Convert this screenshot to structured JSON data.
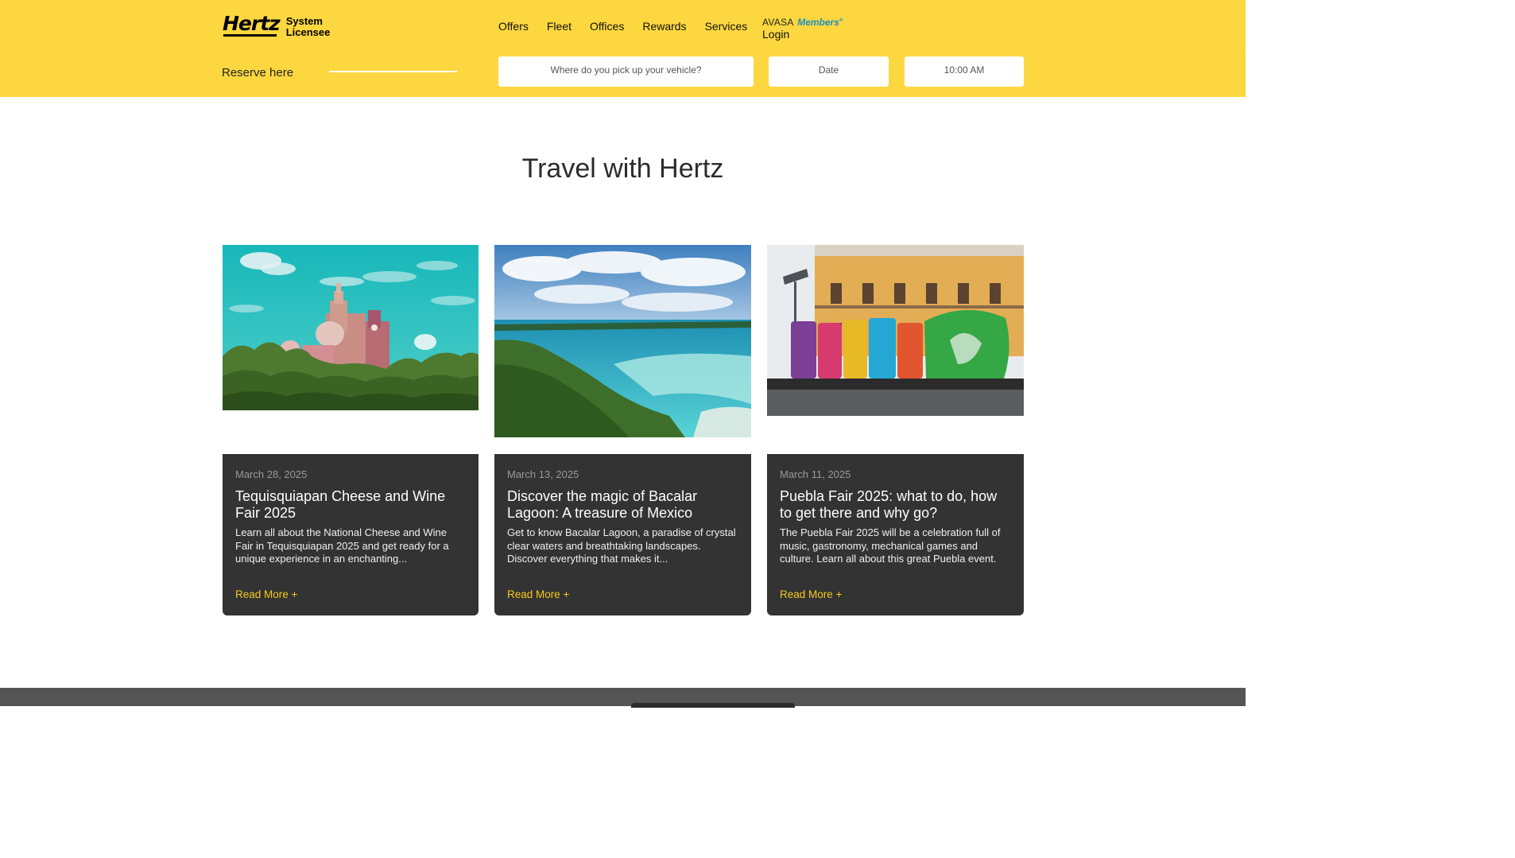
{
  "brand": {
    "logo_text": "Hertz",
    "sub_line1": "System",
    "sub_line2": "Licensee",
    "accent_color": "#fdd73f"
  },
  "nav": {
    "items": [
      {
        "label": "Offers"
      },
      {
        "label": "Fleet"
      },
      {
        "label": "Offices"
      },
      {
        "label": "Rewards"
      },
      {
        "label": "Services"
      }
    ],
    "login": {
      "program": "AVASA",
      "members": "Members",
      "label": "Login"
    }
  },
  "reserve": {
    "label": "Reserve here",
    "location_placeholder": "Where do you pick up your vehicle?",
    "date_placeholder": "Date",
    "time_value": "10:00 AM"
  },
  "main": {
    "title": "Travel with Hertz",
    "cards": [
      {
        "date": "March 28, 2025",
        "title": "Tequisquiapan Cheese and Wine Fair 2025",
        "description": "Learn all about the National Cheese and Wine Fair in Tequisquiapan 2025 and get ready for a unique experience in an enchanting...",
        "link": "Read More +",
        "image": "church-landscape-photo"
      },
      {
        "date": "March 13, 2025",
        "title": "Discover the magic of Bacalar Lagoon: A treasure of Mexico",
        "description": "Get to know Bacalar Lagoon, a paradise of crystal clear waters and breathtaking landscapes. Discover everything that makes it...",
        "link": "Read More +",
        "image": "lagoon-aerial-photo"
      },
      {
        "date": "March 11, 2025",
        "title": "Puebla Fair 2025: what to do, how to get there and why go?",
        "description": "The Puebla Fair 2025 will be a celebration full of music, gastronomy, mechanical games and culture. Learn all about this great Puebla event.",
        "link": "Read More +",
        "image": "puebla-letters-photo"
      }
    ]
  }
}
